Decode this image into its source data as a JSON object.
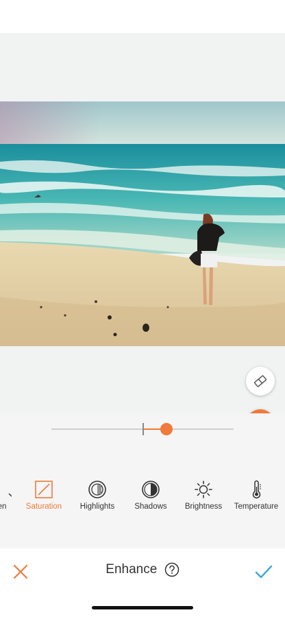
{
  "toolbar": {
    "title": "Enhance",
    "help_icon": "question-circle-icon",
    "close_icon": "close-x-icon",
    "confirm_icon": "checkmark-icon"
  },
  "adjustment": {
    "value_fraction": 0.13
  },
  "tools": [
    {
      "label": "en",
      "icon": "partial-tool-icon",
      "active": false
    },
    {
      "label": "Saturation",
      "icon": "saturation-icon",
      "active": true
    },
    {
      "label": "Highlights",
      "icon": "highlights-icon",
      "active": false
    },
    {
      "label": "Shadows",
      "icon": "shadows-icon",
      "active": false
    },
    {
      "label": "Brightness",
      "icon": "sun-icon",
      "active": false
    },
    {
      "label": "Temperature",
      "icon": "thermometer-icon",
      "active": false
    }
  ],
  "canvas_buttons": {
    "eraser_icon": "eraser-icon",
    "compare_icon": "compare-icon"
  },
  "colors": {
    "accent": "#f07a3b",
    "checkmark": "#3aa8dc",
    "text": "#333333",
    "panel": "#f5f5f5"
  }
}
